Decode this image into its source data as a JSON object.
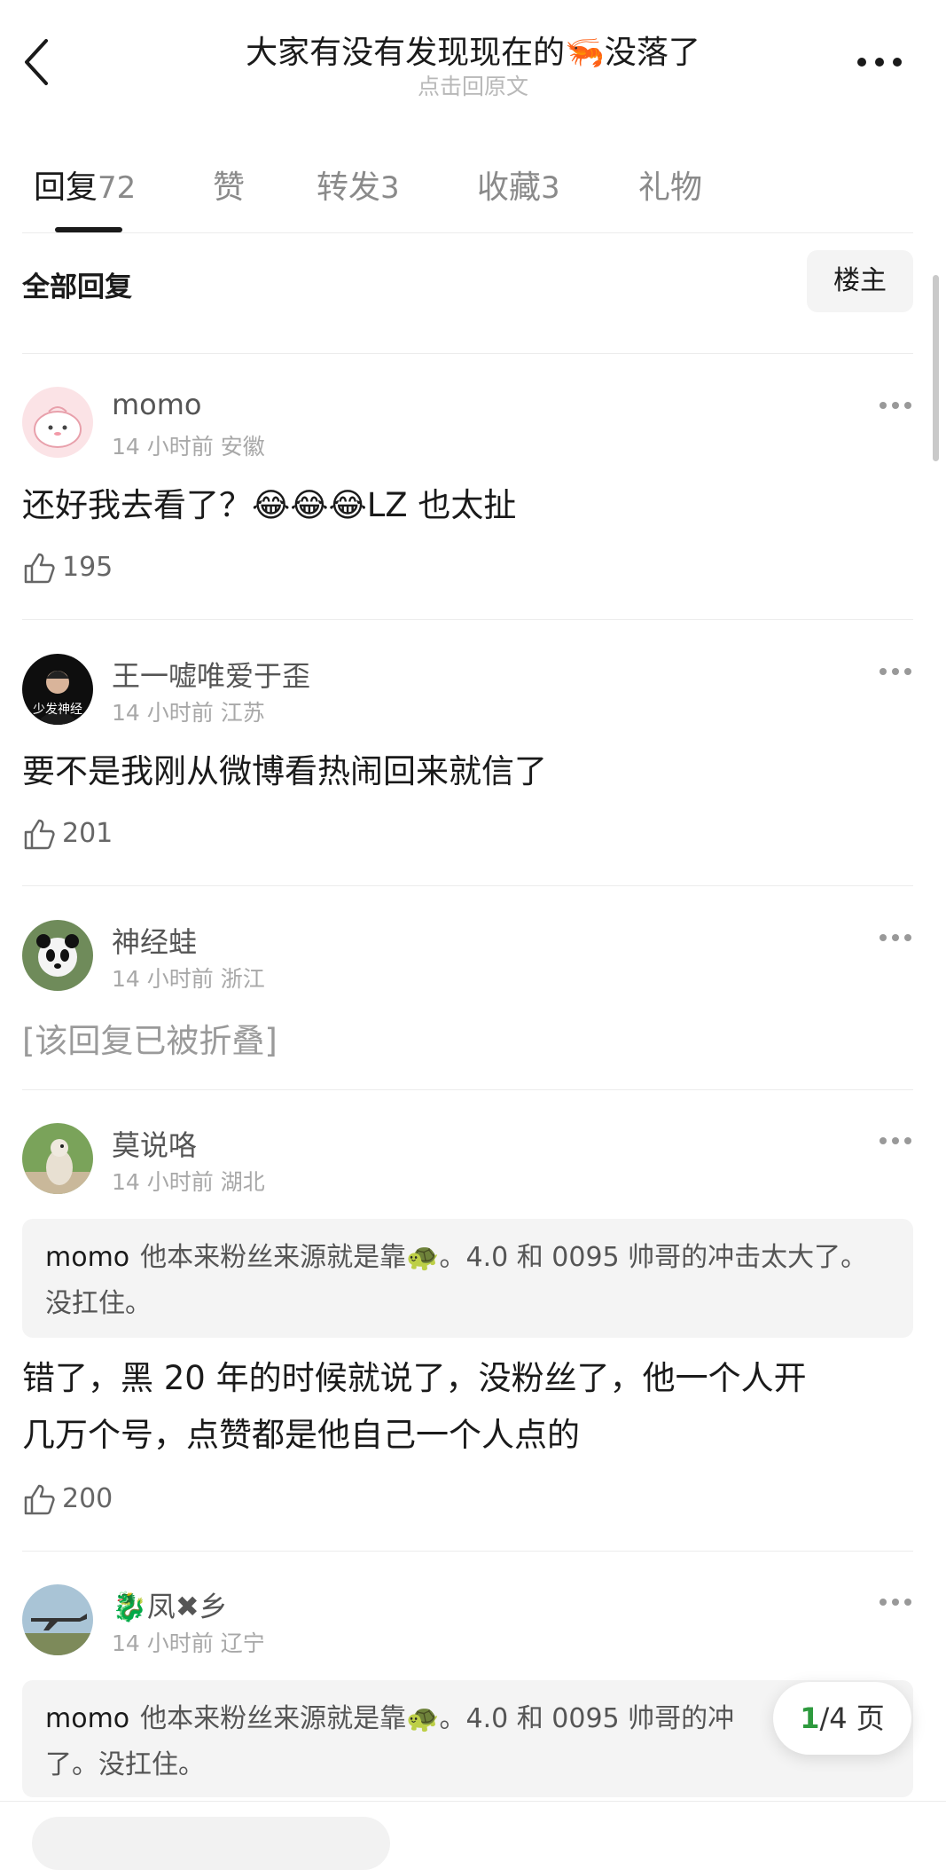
{
  "header": {
    "title": "大家有没有发现现在的🦐没落了",
    "subtitle": "点击回原文"
  },
  "tabs": [
    {
      "label": "回复",
      "count": "72"
    },
    {
      "label": "赞",
      "count": ""
    },
    {
      "label": "转发",
      "count": "3"
    },
    {
      "label": "收藏",
      "count": "3"
    },
    {
      "label": "礼物",
      "count": ""
    }
  ],
  "filter": {
    "all_label": "全部回复",
    "op_label": "楼主"
  },
  "comments": [
    {
      "user": "momo",
      "time": "14 小时前",
      "loc": "安徽",
      "text": "还好我去看了？😂😂😂LZ 也太扯",
      "likes": "195"
    },
    {
      "user": "王一嘘唯爱于歪",
      "time": "14 小时前",
      "loc": "江苏",
      "avatar_text": "少发神经",
      "text": "要不是我刚从微博看热闹回来就信了",
      "likes": "201"
    },
    {
      "user": "神经蛙",
      "time": "14 小时前",
      "loc": "浙江",
      "text": "[该回复已被折叠]"
    },
    {
      "user": "莫说咯",
      "time": "14 小时前",
      "loc": "湖北",
      "quote_user": "momo",
      "quote_text": "他本来粉丝来源就是靠🐢。4.0 和 0095 帅哥的冲击太大了。没扛住。",
      "text_lines": [
        "错了，黑 20 年的时候就说了，没粉丝了，他一个人开",
        "几万个号，点赞都是他自己一个人点的"
      ],
      "likes": "200"
    },
    {
      "user": "🐉凤✖乡",
      "time": "14 小时前",
      "loc": "辽宁",
      "quote_user": "momo",
      "quote_text": "他本来粉丝来源就是靠🐢。4.0 和 0095 帅哥的冲",
      "quote_text2": "了。没扛住。"
    }
  ],
  "pager": {
    "current": "1",
    "total": "/4 页"
  },
  "colors": {
    "accent_green": "#2e9a3e",
    "text_dark": "#1a1a1a",
    "text_muted": "#a8a8a8"
  }
}
